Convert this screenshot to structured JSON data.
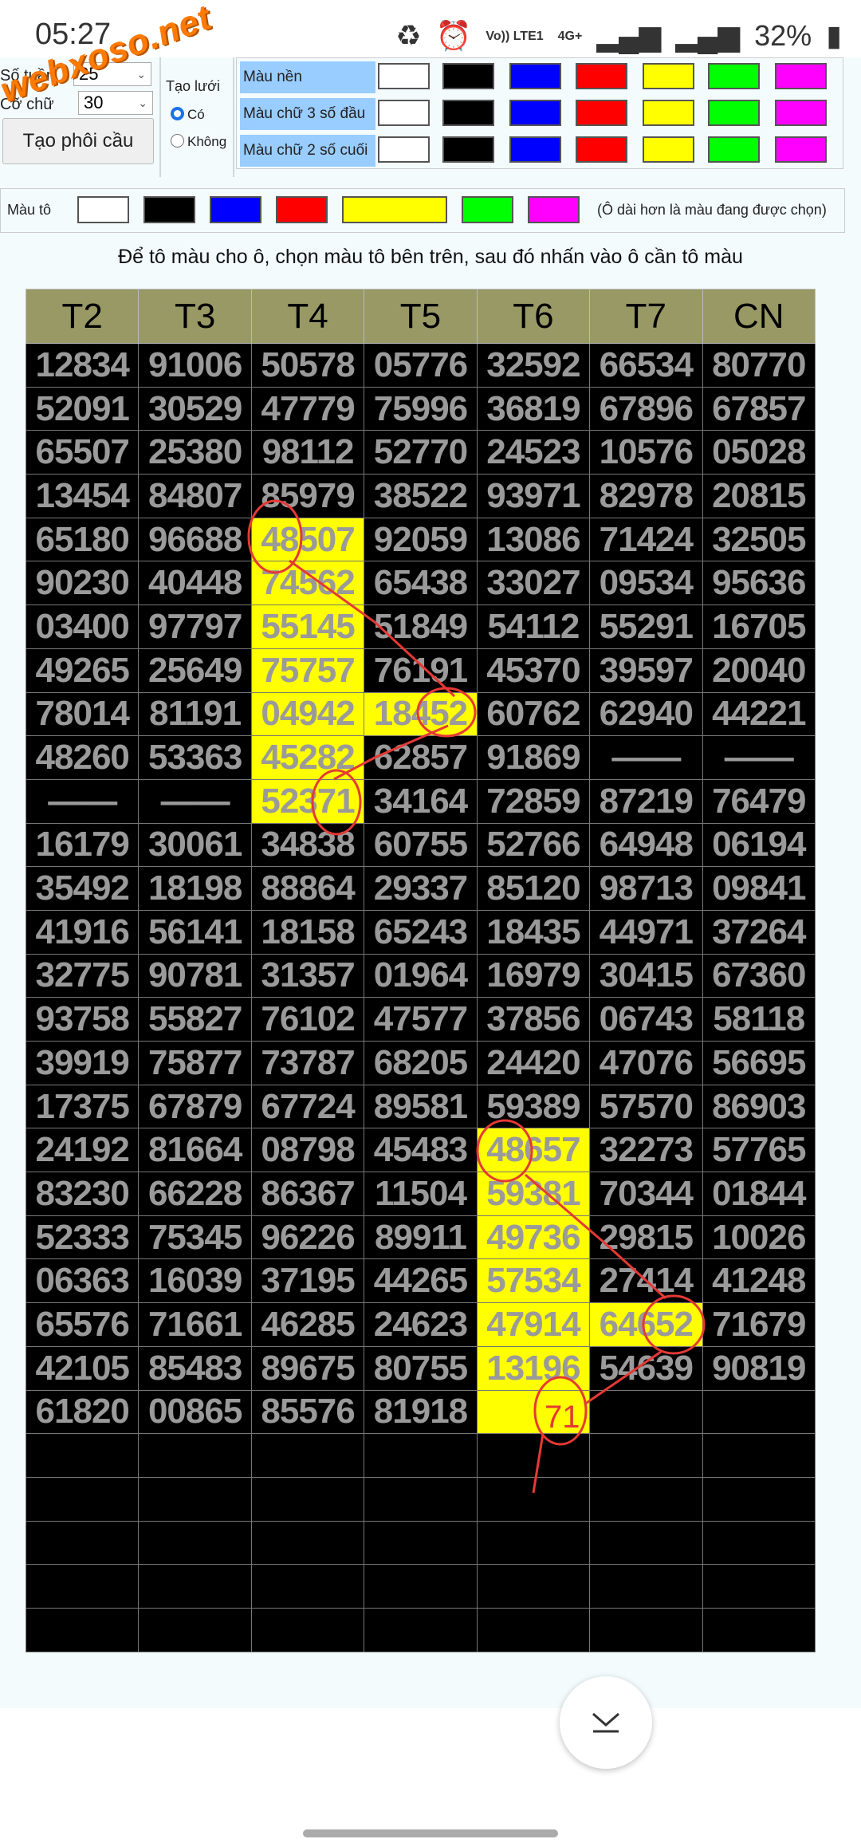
{
  "status_bar": {
    "time": "05:27",
    "network": "Vo)) LTE1",
    "data": "4G+",
    "battery": "32%"
  },
  "watermark": "webxoso.net",
  "controls": {
    "weeks_label": "Số tuần",
    "weeks_value": "25",
    "font_size_label": "Cỡ chữ",
    "font_size_value": "30",
    "generate_button": "Tạo phôi cầu",
    "grid_label": "Tạo lưới",
    "grid_yes": "Có",
    "grid_no": "Không",
    "grid_selected": "Có"
  },
  "color_rows": [
    {
      "label": "Màu nền"
    },
    {
      "label": "Màu chữ 3 số đầu"
    },
    {
      "label": "Màu chữ 2 số cuối"
    }
  ],
  "palette": [
    "#ffffff",
    "#000000",
    "#0000ff",
    "#ff0000",
    "#ffff00",
    "#00ff00",
    "#ff00ff"
  ],
  "fill": {
    "label": "Màu tô",
    "note": "(Ô dài hơn là màu đang được chọn)",
    "selected": "#ffff00"
  },
  "instruction": "Để tô màu cho ô, chọn màu tô bên trên, sau đó nhấn vào ô cần tô màu",
  "table": {
    "headers": [
      "T2",
      "T3",
      "T4",
      "T5",
      "T6",
      "T7",
      "CN"
    ],
    "rows": [
      [
        "12834",
        "91006",
        "50578",
        "05776",
        "32592",
        "66534",
        "80770"
      ],
      [
        "52091",
        "30529",
        "47779",
        "75996",
        "36819",
        "67896",
        "67857"
      ],
      [
        "65507",
        "25380",
        "98112",
        "52770",
        "24523",
        "10576",
        "05028"
      ],
      [
        "13454",
        "84807",
        "85979",
        "38522",
        "93971",
        "82978",
        "20815"
      ],
      [
        "65180",
        "96688",
        "48507",
        "92059",
        "13086",
        "71424",
        "32505"
      ],
      [
        "90230",
        "40448",
        "74562",
        "65438",
        "33027",
        "09534",
        "95636"
      ],
      [
        "03400",
        "97797",
        "55145",
        "51849",
        "54112",
        "55291",
        "16705"
      ],
      [
        "49265",
        "25649",
        "75757",
        "76191",
        "45370",
        "39597",
        "20040"
      ],
      [
        "78014",
        "81191",
        "04942",
        "18452",
        "60762",
        "62940",
        "44221"
      ],
      [
        "48260",
        "53363",
        "45282",
        "62857",
        "91869",
        "——",
        "——"
      ],
      [
        "——",
        "——",
        "52371",
        "34164",
        "72859",
        "87219",
        "76479"
      ],
      [
        "16179",
        "30061",
        "34838",
        "60755",
        "52766",
        "64948",
        "06194"
      ],
      [
        "35492",
        "18198",
        "88864",
        "29337",
        "85120",
        "98713",
        "09841"
      ],
      [
        "41916",
        "56141",
        "18158",
        "65243",
        "18435",
        "44971",
        "37264"
      ],
      [
        "32775",
        "90781",
        "31357",
        "01964",
        "16979",
        "30415",
        "67360"
      ],
      [
        "93758",
        "55827",
        "76102",
        "47577",
        "37856",
        "06743",
        "58118"
      ],
      [
        "39919",
        "75877",
        "73787",
        "68205",
        "24420",
        "47076",
        "56695"
      ],
      [
        "17375",
        "67879",
        "67724",
        "89581",
        "59389",
        "57570",
        "86903"
      ],
      [
        "24192",
        "81664",
        "08798",
        "45483",
        "48657",
        "32273",
        "57765"
      ],
      [
        "83230",
        "66228",
        "86367",
        "11504",
        "59381",
        "70344",
        "01844"
      ],
      [
        "52333",
        "75345",
        "96226",
        "89911",
        "49736",
        "29815",
        "10026"
      ],
      [
        "06363",
        "16039",
        "37195",
        "44265",
        "57534",
        "27414",
        "41248"
      ],
      [
        "65576",
        "71661",
        "46285",
        "24623",
        "47914",
        "64652",
        "71679"
      ],
      [
        "42105",
        "85483",
        "89675",
        "80755",
        "13196",
        "54639",
        "90819"
      ],
      [
        "61820",
        "00865",
        "85576",
        "81918",
        "",
        "",
        ""
      ],
      [
        "",
        "",
        "",
        "",
        "",
        "",
        ""
      ],
      [
        "",
        "",
        "",
        "",
        "",
        "",
        ""
      ],
      [
        "",
        "",
        "",
        "",
        "",
        "",
        ""
      ],
      [
        "",
        "",
        "",
        "",
        "",
        "",
        ""
      ],
      [
        "",
        "",
        "",
        "",
        "",
        "",
        ""
      ]
    ],
    "highlighted_cells": [
      [
        4,
        2
      ],
      [
        5,
        2
      ],
      [
        6,
        2
      ],
      [
        7,
        2
      ],
      [
        8,
        2
      ],
      [
        9,
        2
      ],
      [
        10,
        2
      ],
      [
        8,
        3
      ],
      [
        18,
        4
      ],
      [
        19,
        4
      ],
      [
        20,
        4
      ],
      [
        21,
        4
      ],
      [
        22,
        4
      ],
      [
        23,
        4
      ],
      [
        24,
        4
      ],
      [
        22,
        5
      ]
    ],
    "highlight_color": "#ffff00",
    "cell_bg": "#000000",
    "text_color": "#9a9a9a",
    "header_bg": "#999966"
  },
  "annotation": {
    "text": "71",
    "color": "#e53935"
  }
}
